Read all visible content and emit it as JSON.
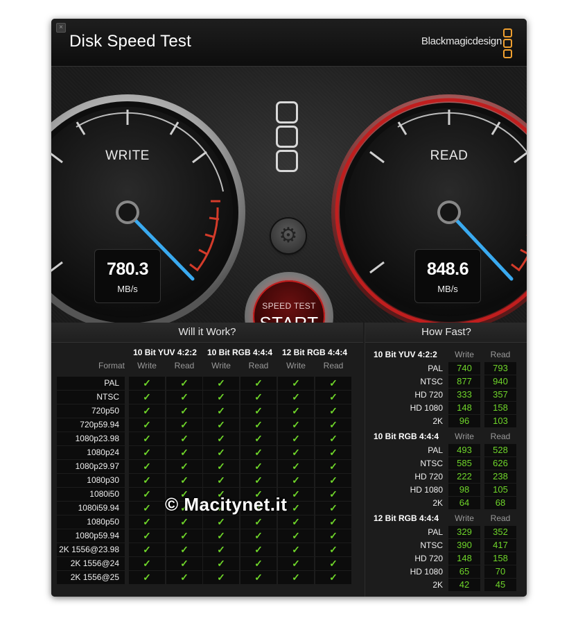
{
  "window": {
    "title": "Disk Speed Test",
    "brand": "Blackmagicdesign",
    "close_glyph": "×"
  },
  "write_gauge": {
    "label": "WRITE",
    "value": "780.3",
    "unit": "MB/s"
  },
  "read_gauge": {
    "label": "READ",
    "value": "848.6",
    "unit": "MB/s"
  },
  "start_button": {
    "small": "SPEED TEST",
    "big": "START"
  },
  "icons": {
    "settings": "gear-icon",
    "logo": "blackmagic-logo-icon",
    "check": "✓"
  },
  "colors": {
    "accent_red": "#c81e1e",
    "needle_blue": "#3aaaf0",
    "check_green": "#6fd62a",
    "brand_orange": "#f0a030"
  },
  "will_it_work": {
    "header": "Will it Work?",
    "format_label": "Format",
    "groups": [
      "10 Bit YUV 4:2:2",
      "10 Bit RGB 4:4:4",
      "12 Bit RGB 4:4:4"
    ],
    "write_label": "Write",
    "read_label": "Read",
    "formats": [
      "PAL",
      "NTSC",
      "720p50",
      "720p59.94",
      "1080p23.98",
      "1080p24",
      "1080p29.97",
      "1080p30",
      "1080i50",
      "1080i59.94",
      "1080p50",
      "1080p59.94",
      "2K 1556@23.98",
      "2K 1556@24",
      "2K 1556@25"
    ]
  },
  "how_fast": {
    "header": "How Fast?",
    "write_label": "Write",
    "read_label": "Read",
    "groups": [
      {
        "title": "10 Bit YUV 4:2:2",
        "rows": [
          {
            "name": "PAL",
            "write": "740",
            "read": "793"
          },
          {
            "name": "NTSC",
            "write": "877",
            "read": "940"
          },
          {
            "name": "HD 720",
            "write": "333",
            "read": "357"
          },
          {
            "name": "HD 1080",
            "write": "148",
            "read": "158"
          },
          {
            "name": "2K",
            "write": "96",
            "read": "103"
          }
        ]
      },
      {
        "title": "10 Bit RGB 4:4:4",
        "rows": [
          {
            "name": "PAL",
            "write": "493",
            "read": "528"
          },
          {
            "name": "NTSC",
            "write": "585",
            "read": "626"
          },
          {
            "name": "HD 720",
            "write": "222",
            "read": "238"
          },
          {
            "name": "HD 1080",
            "write": "98",
            "read": "105"
          },
          {
            "name": "2K",
            "write": "64",
            "read": "68"
          }
        ]
      },
      {
        "title": "12 Bit RGB 4:4:4",
        "rows": [
          {
            "name": "PAL",
            "write": "329",
            "read": "352"
          },
          {
            "name": "NTSC",
            "write": "390",
            "read": "417"
          },
          {
            "name": "HD 720",
            "write": "148",
            "read": "158"
          },
          {
            "name": "HD 1080",
            "write": "65",
            "read": "70"
          },
          {
            "name": "2K",
            "write": "42",
            "read": "45"
          }
        ]
      }
    ]
  },
  "watermark": "© Macitynet.it"
}
